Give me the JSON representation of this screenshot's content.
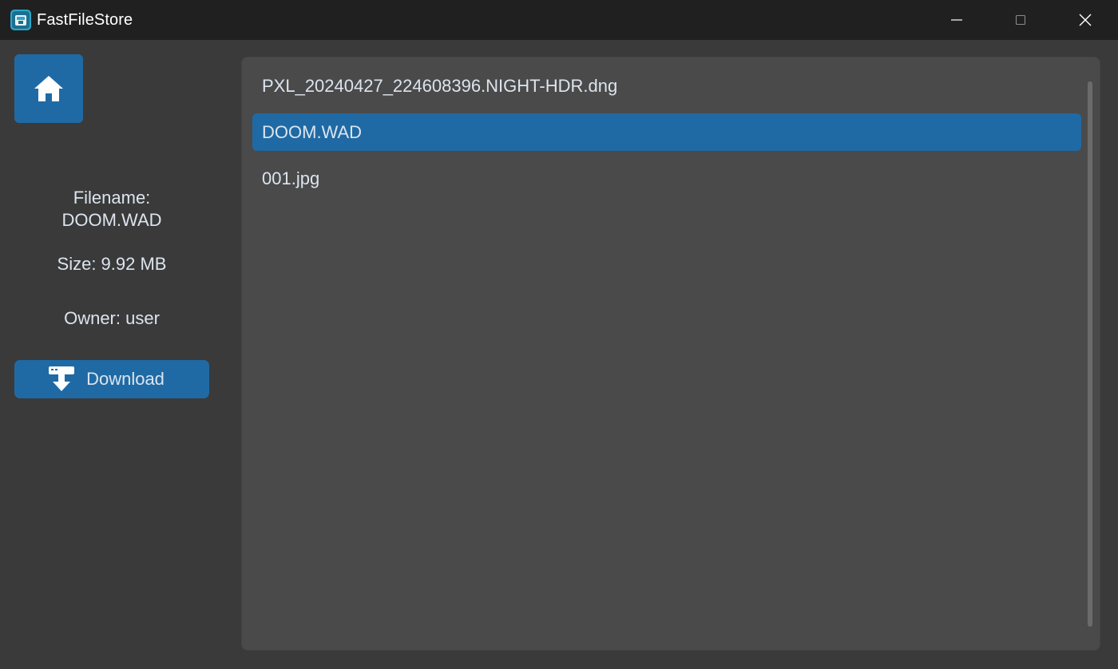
{
  "window": {
    "title": "FastFileStore"
  },
  "titlebar": {
    "app_icon": "app-box-icon",
    "minimize_icon": "minimize-icon",
    "maximize_icon": "maximize-icon",
    "close_icon": "close-icon"
  },
  "sidebar": {
    "home_icon": "home-icon",
    "filename_label": "Filename:",
    "filename_value": "DOOM.WAD",
    "size_text": "Size: 9.92 MB",
    "owner_text": "Owner: user",
    "download_label": "Download",
    "download_icon": "download-icon"
  },
  "files": {
    "items": [
      {
        "name": "PXL_20240427_224608396.NIGHT-HDR.dng",
        "selected": false
      },
      {
        "name": "DOOM.WAD",
        "selected": true
      },
      {
        "name": "001.jpg",
        "selected": false
      }
    ]
  },
  "colors": {
    "accent": "#1f6aa5",
    "background": "#3a3a3a",
    "panel": "#4a4a4a",
    "titlebar": "#202020",
    "text": "#dce4ee"
  }
}
